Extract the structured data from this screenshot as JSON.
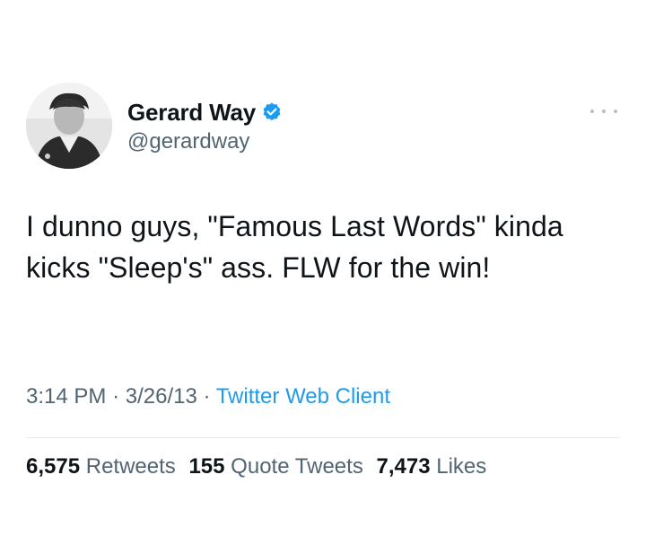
{
  "author": {
    "name": "Gerard Way",
    "handle": "@gerardway",
    "avatar_icon": "profile-photo",
    "verified_icon": "verified-badge-icon",
    "verified_color": "#1d9bf0"
  },
  "tweet": {
    "text": "I dunno guys, \"Famous Last Words\" kinda kicks \"Sleep's\" ass. FLW for the win!",
    "time": "3:14 PM",
    "date": "3/26/13",
    "separator": "·",
    "client": "Twitter Web Client"
  },
  "stats": {
    "retweets_count": "6,575",
    "retweets_label": "Retweets",
    "quotes_count": "155",
    "quotes_label": "Quote Tweets",
    "likes_count": "7,473",
    "likes_label": "Likes"
  },
  "colors": {
    "text": "#0f1419",
    "secondary": "#536471",
    "link": "#1d9bf0",
    "divider": "#e6e9eb"
  }
}
